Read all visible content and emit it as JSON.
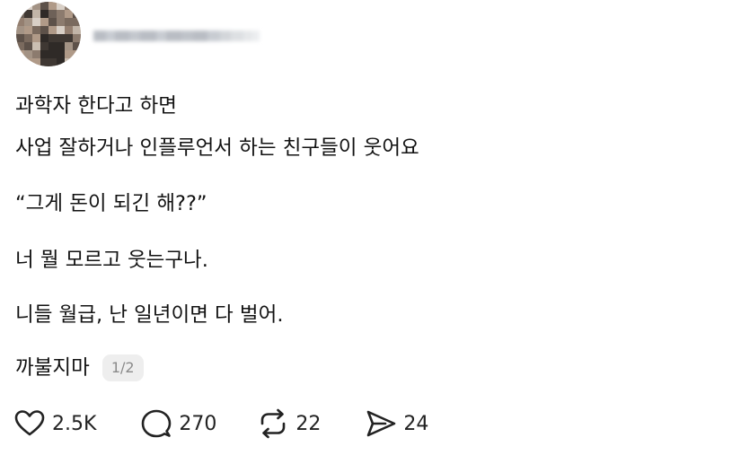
{
  "post": {
    "author_avatar_icon": "blurred-profile-photo",
    "body_lines": [
      "과학자 한다고 하면",
      "사업 잘하거나 인플루언서 하는 친구들이 웃어요",
      "“그게 돈이 되긴 해??”",
      "너 뭘 모르고 웃는구나.",
      "니들 월급, 난 일년이면 다 벌어.",
      "까불지마"
    ],
    "page_indicator": "1/2"
  },
  "actions": {
    "like": {
      "icon": "heart-icon",
      "count": "2.5K"
    },
    "comment": {
      "icon": "speech-bubble-icon",
      "count": "270"
    },
    "repost": {
      "icon": "repost-icon",
      "count": "22"
    },
    "share": {
      "icon": "send-icon",
      "count": "24"
    }
  },
  "colors": {
    "text": "#121212",
    "badge_bg": "#eeeeee",
    "badge_text": "#8a8a8a"
  }
}
